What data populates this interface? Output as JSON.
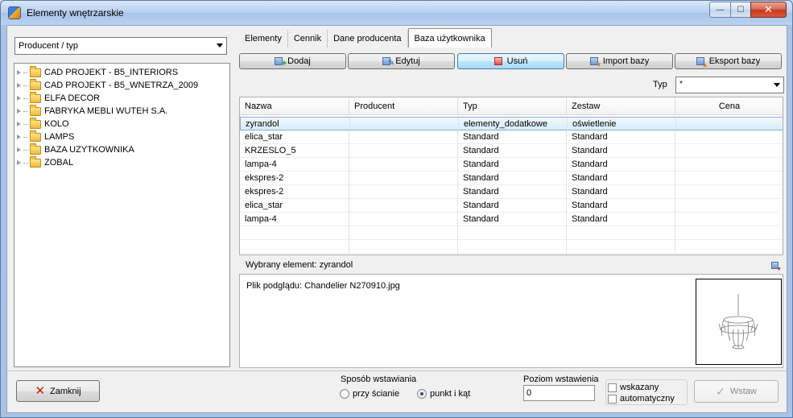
{
  "window": {
    "title": "Elementy wnętrzarskie",
    "min_glyph": "—",
    "max_glyph": "☐",
    "close_glyph": "✕"
  },
  "left": {
    "combo_value": "Producent / typ",
    "tree_items": [
      "CAD PROJEKT - B5_INTERIORS",
      "CAD PROJEKT - B5_WNETRZA_2009",
      "ELFA DECOR",
      "FABRYKA MEBLI WUTEH S.A.",
      "KOLO",
      "LAMPS",
      "BAZA UZYTKOWNIKA",
      "ZOBAL"
    ]
  },
  "tabs": [
    "Elementy",
    "Cennik",
    "Dane producenta",
    "Baza użytkownika"
  ],
  "toolbar": {
    "add": "Dodaj",
    "edit": "Edytuj",
    "delete": "Usuń",
    "import": "Import bazy",
    "export": "Eksport bazy"
  },
  "filter": {
    "type_label": "Typ",
    "type_value": "*"
  },
  "grid": {
    "headers": [
      "Nazwa",
      "Producent",
      "Typ",
      "Zestaw",
      "Cena"
    ],
    "rows": [
      [
        "zyrandol",
        "",
        "elementy_dodatkowe",
        "oświetlenie",
        ""
      ],
      [
        "elica_star",
        "",
        "Standard",
        "Standard",
        ""
      ],
      [
        "KRZESLO_5",
        "",
        "Standard",
        "Standard",
        ""
      ],
      [
        "lampa-4",
        "",
        "Standard",
        "Standard",
        ""
      ],
      [
        "ekspres-2",
        "",
        "Standard",
        "Standard",
        ""
      ],
      [
        "ekspres-2",
        "",
        "Standard",
        "Standard",
        ""
      ],
      [
        "elica_star",
        "",
        "Standard",
        "Standard",
        ""
      ],
      [
        "lampa-4",
        "",
        "Standard",
        "Standard",
        ""
      ],
      [
        "",
        "",
        "",
        "",
        ""
      ],
      [
        "",
        "",
        "",
        "",
        ""
      ]
    ],
    "selected_row": 0
  },
  "selection": {
    "text": "Wybrany element: zyrandol",
    "preview_text": "Plik podglądu: Chandelier N270910.jpg"
  },
  "bottom": {
    "close_label": "Zamknij",
    "insert_mode_label": "Sposób wstawiania",
    "radio_wall": "przy ścianie",
    "radio_point": "punkt i kąt",
    "level_label": "Poziom wstawienia",
    "level_value": "0",
    "chk_indicated": "wskazany",
    "chk_auto": "automatyczny",
    "insert_label": "Wstaw"
  }
}
